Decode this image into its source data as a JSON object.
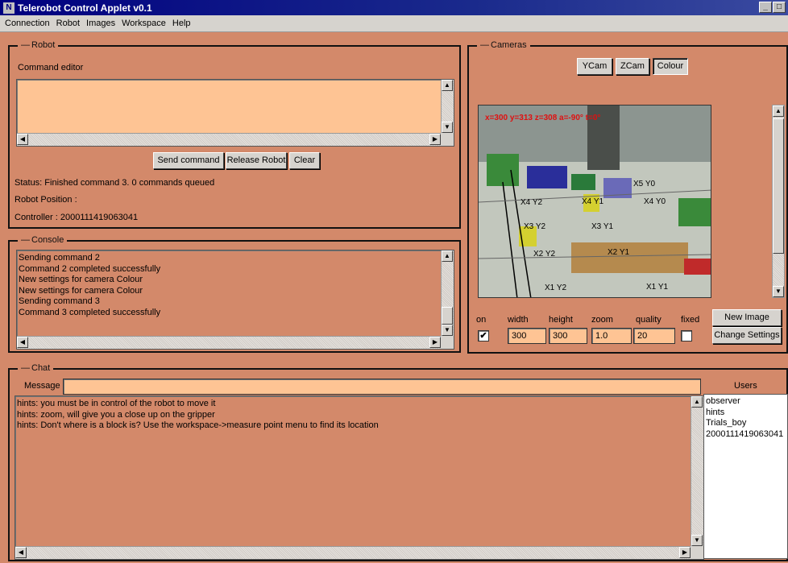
{
  "window": {
    "title": "Telerobot Control Applet v0.1",
    "icon_name": "app-icon",
    "minimize": "_",
    "maximize": "□"
  },
  "menu": [
    "Connection",
    "Robot",
    "Images",
    "Workspace",
    "Help"
  ],
  "robot": {
    "group_title": "Robot",
    "command_editor_label": "Command editor",
    "command_text": "",
    "buttons": {
      "send": "Send command",
      "release": "Release Robot",
      "clear": "Clear"
    },
    "status": "Status: Finished  command 3. 0 commands queued",
    "position": "Robot Position :",
    "controller": "Controller : 2000111419063041"
  },
  "console": {
    "group_title": "Console",
    "lines": [
      "Sending command 2",
      "Command 2 completed successfully",
      "New settings for camera Colour",
      "New settings for camera Colour",
      "Sending command 3",
      "Command 3 completed successfully"
    ]
  },
  "cameras": {
    "group_title": "Cameras",
    "buttons": {
      "ycam": "YCam",
      "zcam": "ZCam",
      "colour": "Colour"
    },
    "overlay_text": "x=300 y=313 z=308 a=-90° t=0°",
    "overlay_labels": [
      "X5 Y0",
      "X4 Y2",
      "X4 Y1",
      "X4 Y0",
      "X3 Y2",
      "X3 Y1",
      "X2 Y2",
      "X2 Y1",
      "X1 Y2",
      "X1 Y1"
    ],
    "settings": {
      "labels": {
        "on": "on",
        "width": "width",
        "height": "height",
        "zoom": "zoom",
        "quality": "quality",
        "fixed": "fixed"
      },
      "values": {
        "on": true,
        "width": "300",
        "height": "300",
        "zoom": "1.0",
        "quality": "20",
        "fixed": false
      }
    },
    "new_image": "New Image",
    "change_settings": "Change Settings"
  },
  "chat": {
    "group_title": "Chat",
    "message_label": "Message",
    "message_value": "",
    "users_label": "Users",
    "users": [
      "observer",
      "hints",
      "Trials_boy",
      "2000111419063041"
    ],
    "lines": [
      "hints: you must be in control of the robot to move it",
      "hints: zoom, will give you a close up on the gripper",
      "hints: Don't where is a block is? Use the workspace->measure point menu to find its location"
    ]
  },
  "colors": {
    "panel_bg": "#d3896a",
    "field_bg": "#fec494",
    "titlebar": "#000080"
  }
}
